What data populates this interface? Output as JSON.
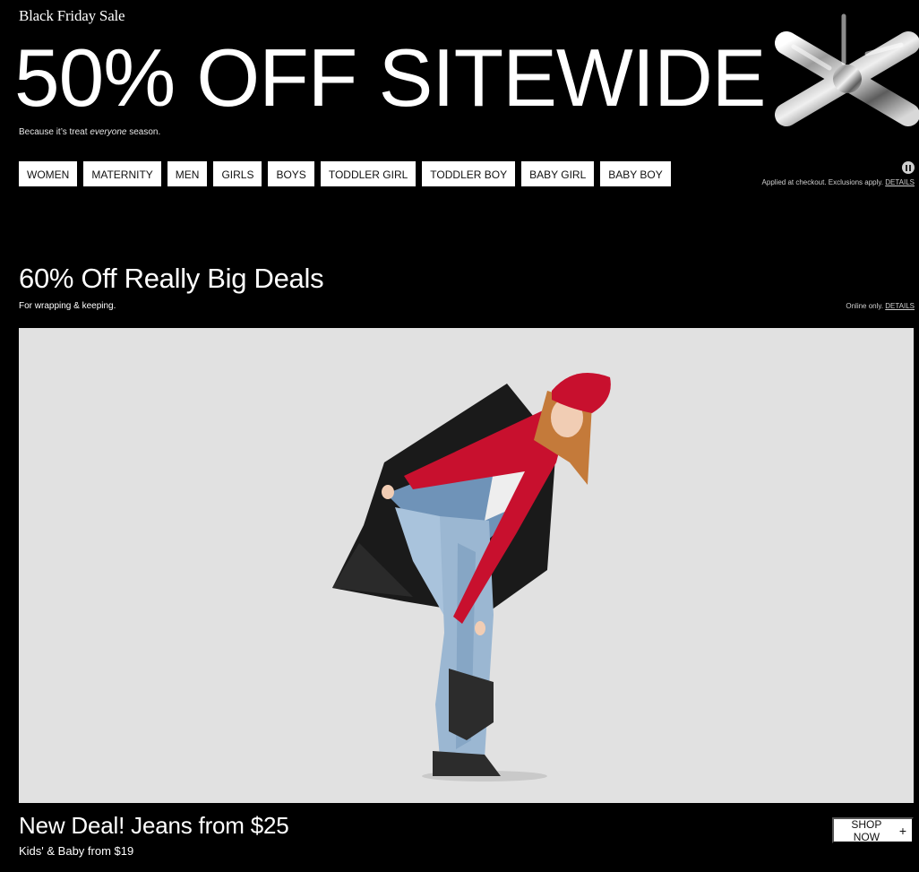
{
  "hero": {
    "eyebrow": "Black Friday Sale",
    "headline": "50% OFF SITEWIDE",
    "sub_prefix": "Because it’s treat ",
    "sub_emphasis": "everyone",
    "sub_suffix": " season.",
    "legal_text": "Applied at checkout. Exclusions apply. ",
    "legal_link": "DETAILS",
    "pause_icon": "pause-icon",
    "departments": [
      "WOMEN",
      "MATERNITY",
      "MEN",
      "GIRLS",
      "BOYS",
      "TODDLER GIRL",
      "TODDLER BOY",
      "BABY GIRL",
      "BABY BOY"
    ]
  },
  "deals": {
    "title": "60% Off Really Big Deals",
    "subtitle": "For wrapping & keeping.",
    "legal_text": "Online only. ",
    "legal_link": "DETAILS",
    "image_subject": "model-in-jeans-red-scarf-photo",
    "headline": "New Deal! Jeans from $25",
    "subline": "Kids' & Baby from $19",
    "cta_label": "SHOP NOW",
    "cta_icon": "+"
  },
  "colors": {
    "background": "#000000",
    "text": "#ffffff",
    "button_bg": "#ffffff",
    "button_text": "#111111",
    "image_bg": "#e1e1e1",
    "accent_red": "#c8102e"
  }
}
